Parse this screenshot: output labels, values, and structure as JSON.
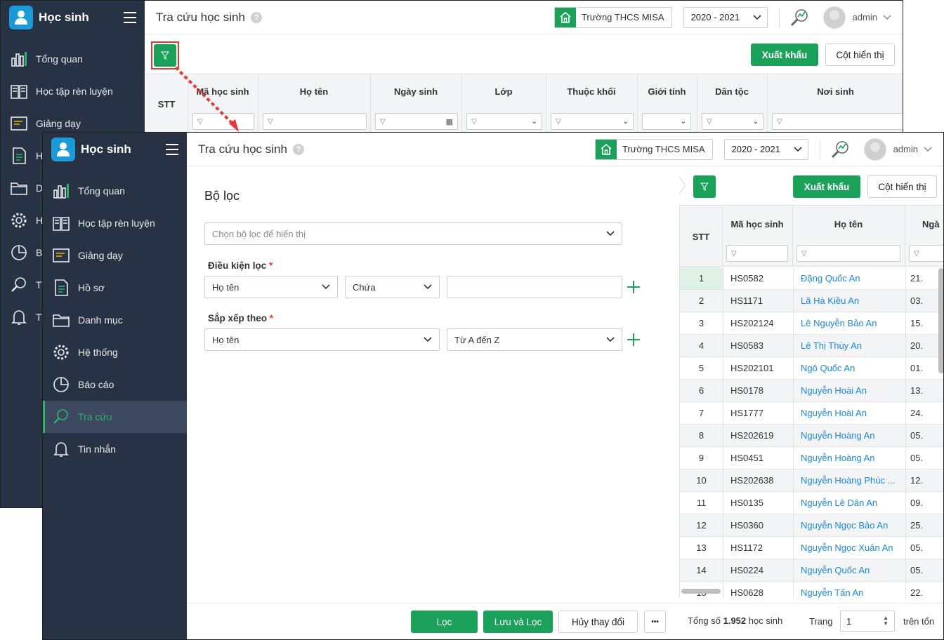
{
  "app": {
    "title": "Học sinh"
  },
  "back_sidebar": {
    "items": [
      {
        "label": "Tổng quan",
        "icon": "chart-bars-icon"
      },
      {
        "label": "Học tập rèn luyện",
        "icon": "book-icon"
      },
      {
        "label": "Giảng dạy",
        "icon": "board-icon"
      },
      {
        "label": "H",
        "icon": "document-icon"
      },
      {
        "label": "D",
        "icon": "folder-icon"
      },
      {
        "label": "H",
        "icon": "gear-icon"
      },
      {
        "label": "B",
        "icon": "pie-icon"
      },
      {
        "label": "T",
        "icon": "search-icon"
      },
      {
        "label": "Ti",
        "icon": "bell-icon"
      }
    ]
  },
  "sidebar": {
    "items": [
      {
        "label": "Tổng quan",
        "icon": "chart-bars-icon"
      },
      {
        "label": "Học tập rèn luyện",
        "icon": "book-icon"
      },
      {
        "label": "Giảng dạy",
        "icon": "board-icon"
      },
      {
        "label": "Hồ sơ",
        "icon": "document-icon"
      },
      {
        "label": "Danh mục",
        "icon": "folder-icon"
      },
      {
        "label": "Hệ thống",
        "icon": "gear-icon"
      },
      {
        "label": "Báo cáo",
        "icon": "pie-icon"
      },
      {
        "label": "Tra cứu",
        "icon": "search-icon",
        "active": true
      },
      {
        "label": "Tin nhắn",
        "icon": "bell-icon"
      }
    ]
  },
  "header": {
    "page_title": "Tra cứu học sinh",
    "help": "?",
    "school": "Trường THCS MISA",
    "year": "2020 - 2021",
    "user": "admin"
  },
  "toolbar": {
    "export": "Xuất khẩu",
    "columns": "Cột hiển thị"
  },
  "back_table": {
    "headers": [
      "STT",
      "Mã học sinh",
      "Họ tên",
      "Ngày sinh",
      "Lớp",
      "Thuộc khối",
      "Giới tính",
      "Dân tộc",
      "Nơi sinh"
    ]
  },
  "filter_panel": {
    "title": "Bộ lọc",
    "preset_placeholder": "Chọn bộ lọc để hiển thị",
    "condition_label": "Điều kiện lọc",
    "condition_field": "Họ tên",
    "condition_op": "Chứa",
    "condition_value": "",
    "sort_label": "Sắp xếp theo",
    "sort_field": "Họ tên",
    "sort_order": "Từ A đến Z",
    "required_mark": "*"
  },
  "footer": {
    "filter": "Lọc",
    "save_filter": "Lưu và Lọc",
    "cancel": "Hủy thay đổi",
    "more": "•••",
    "total_prefix": "Tổng số",
    "total_count": "1.952",
    "total_suffix": "học sinh",
    "page_label": "Trang",
    "page_value": "1",
    "of_total": "trên tổn"
  },
  "table": {
    "headers": [
      "STT",
      "Mã học sinh",
      "Họ tên",
      "Ngà"
    ],
    "rows": [
      {
        "stt": "1",
        "code": "HS0582",
        "name": "Đặng Quốc An",
        "dob": "21."
      },
      {
        "stt": "2",
        "code": "HS1171",
        "name": "Lã Hà Kiều An",
        "dob": "03."
      },
      {
        "stt": "3",
        "code": "HS202124",
        "name": "Lê Nguyễn Bảo An",
        "dob": "15."
      },
      {
        "stt": "4",
        "code": "HS0583",
        "name": "Lê Thị Thùy An",
        "dob": "20."
      },
      {
        "stt": "5",
        "code": "HS202101",
        "name": "Ngô Quốc An",
        "dob": "01."
      },
      {
        "stt": "6",
        "code": "HS0178",
        "name": "Nguyễn Hoài An",
        "dob": "13."
      },
      {
        "stt": "7",
        "code": "HS1777",
        "name": "Nguyễn Hoài An",
        "dob": "24."
      },
      {
        "stt": "8",
        "code": "HS202619",
        "name": "Nguyễn Hoàng An",
        "dob": "05."
      },
      {
        "stt": "9",
        "code": "HS0451",
        "name": "Nguyễn Hoàng An",
        "dob": "05."
      },
      {
        "stt": "10",
        "code": "HS202638",
        "name": "Nguyễn Hoàng Phúc ...",
        "dob": "12."
      },
      {
        "stt": "11",
        "code": "HS0135",
        "name": "Nguyễn Lê Dân An",
        "dob": "09."
      },
      {
        "stt": "12",
        "code": "HS0360",
        "name": "Nguyễn Ngọc Bảo An",
        "dob": "25."
      },
      {
        "stt": "13",
        "code": "HS1172",
        "name": "Nguyễn Ngọc Xuân An",
        "dob": "05."
      },
      {
        "stt": "14",
        "code": "HS0224",
        "name": "Nguyễn Quốc An",
        "dob": "05."
      },
      {
        "stt": "15",
        "code": "HS0628",
        "name": "Nguyễn Tấn An",
        "dob": "22."
      }
    ]
  },
  "colors": {
    "green": "#1ca15b",
    "sidebar": "#273245",
    "link": "#1a88d9",
    "highlight": "#e53935"
  }
}
